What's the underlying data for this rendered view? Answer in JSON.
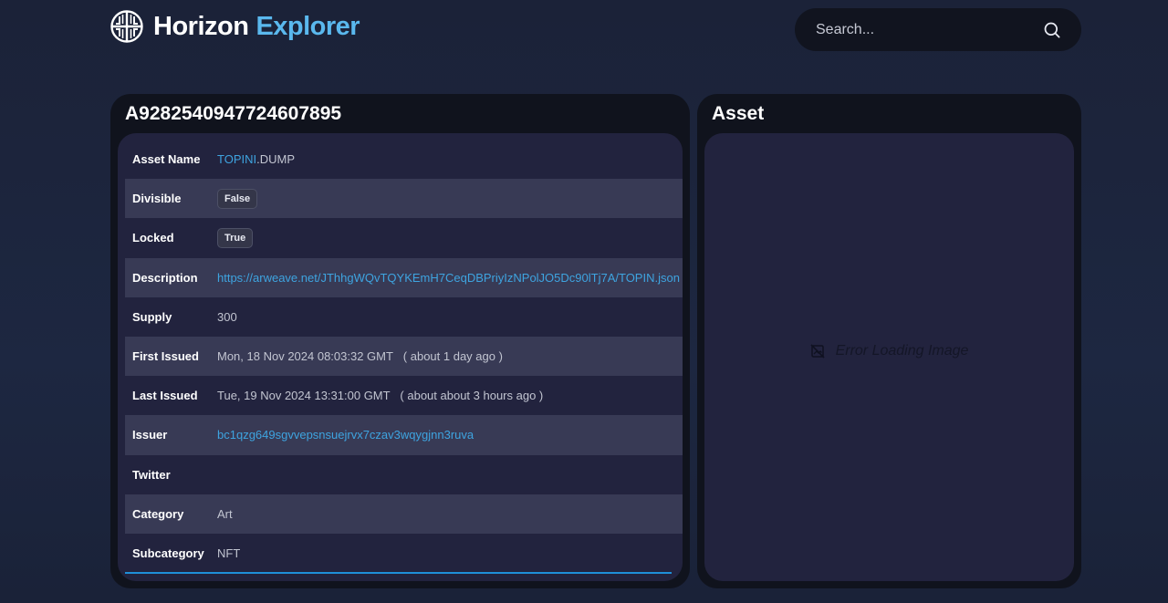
{
  "header": {
    "brand_word1": "Horizon",
    "brand_word2": "Explorer",
    "logo_icon": "horizon-logo-icon",
    "search_placeholder": "Search...",
    "search_icon": "search-icon"
  },
  "asset_panel": {
    "title": "A9282540947724607895",
    "rows": [
      {
        "key": "Asset Name",
        "value_link": "TOPINI",
        "value_rest": ".DUMP"
      },
      {
        "key": "Divisible",
        "badge": "False"
      },
      {
        "key": "Locked",
        "badge": "True"
      },
      {
        "key": "Description",
        "value_link": "https://arweave.net/JThhgWQvTQYKEmH7CeqDBPriyIzNPolJO5Dc90lTj7A/TOPIN.json"
      },
      {
        "key": "Supply",
        "value": "300"
      },
      {
        "key": "First Issued",
        "value": "Mon, 18 Nov 2024 08:03:32 GMT",
        "relative": "( about 1 day ago )"
      },
      {
        "key": "Last Issued",
        "value": "Tue, 19 Nov 2024 13:31:00 GMT",
        "relative": "( about about 3 hours ago )"
      },
      {
        "key": "Issuer",
        "value_link": "bc1qzg649sgvvepsnsuejrvx7czav3wqygjnn3ruva"
      },
      {
        "key": "Twitter",
        "value": ""
      },
      {
        "key": "Category",
        "value": "Art"
      },
      {
        "key": "Subcategory",
        "value": "NFT"
      }
    ]
  },
  "image_panel": {
    "title": "Asset",
    "error_text": "Error Loading Image",
    "error_icon": "broken-image-icon"
  },
  "colors": {
    "accent": "#5ab8ee",
    "link": "#3ea4e0",
    "panel_bg": "#10131d",
    "inner_bg": "#22233e",
    "row_alt": "#383a55"
  }
}
